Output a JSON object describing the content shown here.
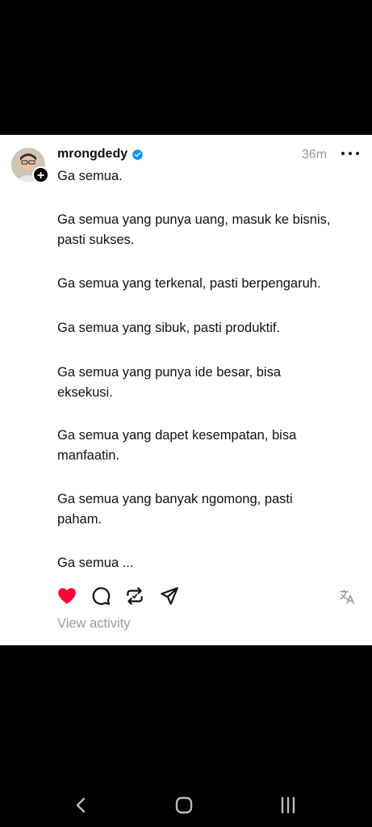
{
  "post": {
    "username": "mrongdedy",
    "verified": true,
    "timestamp": "36m",
    "lines": [
      "Ga semua.",
      "Ga semua yang punya uang, masuk ke bisnis,",
      "pasti sukses.",
      "Ga semua yang terkenal, pasti berpengaruh.",
      "Ga semua yang sibuk, pasti produktif.",
      "Ga semua yang punya ide besar, bisa",
      "eksekusi.",
      "Ga semua yang dapet kesempatan, bisa",
      "manfaatin.",
      "Ga semua yang banyak ngomong, pasti",
      "paham.",
      "Ga semua ..."
    ],
    "view_activity": "View activity"
  },
  "icons": {
    "avatar_plus": "+",
    "like": "heart-icon",
    "comment": "comment-icon",
    "repost": "repost-icon",
    "share": "send-icon",
    "translate": "translate-icon",
    "more": "more-icon"
  },
  "colors": {
    "like": "#ff0034",
    "verified": "#0095f6",
    "muted": "#999999"
  },
  "system_nav": {
    "back": "back-icon",
    "home": "home-icon",
    "recents": "recents-icon"
  }
}
